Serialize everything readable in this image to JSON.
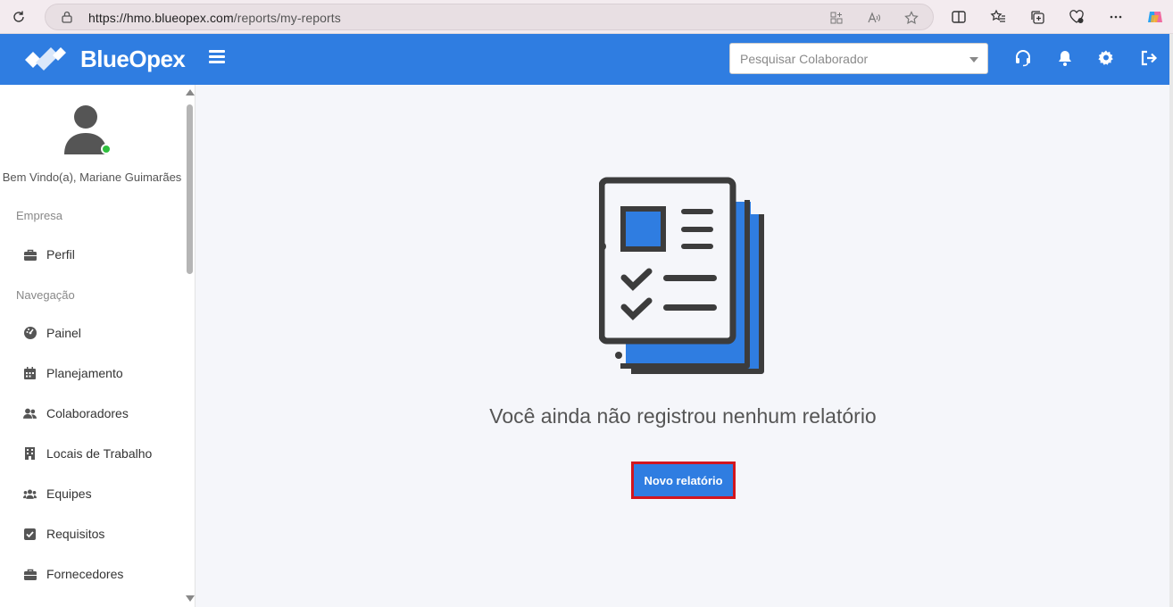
{
  "browser": {
    "url_host": "https://hmo.blueopex.com",
    "url_path": "/reports/my-reports",
    "icons": [
      "reload-icon",
      "lock-icon",
      "apps-icon",
      "read-aloud-icon",
      "favorite-star-icon",
      "split-screen-icon",
      "favorites-icon",
      "collections-icon",
      "health-icon",
      "more-icon",
      "copilot-icon"
    ]
  },
  "header": {
    "brand": "BlueOpex",
    "search_placeholder": "Pesquisar Colaborador",
    "brand_color": "#2f7de1"
  },
  "sidebar": {
    "welcome": "Bem Vindo(a), Mariane Guimarães",
    "section_company": "Empresa",
    "section_navigation": "Navegação",
    "company_items": [
      {
        "label": "Perfil",
        "icon": "briefcase-icon"
      }
    ],
    "nav_items": [
      {
        "label": "Painel",
        "icon": "dashboard-icon"
      },
      {
        "label": "Planejamento",
        "icon": "calendar-icon"
      },
      {
        "label": "Colaboradores",
        "icon": "users-icon"
      },
      {
        "label": "Locais de Trabalho",
        "icon": "building-icon"
      },
      {
        "label": "Equipes",
        "icon": "team-icon"
      },
      {
        "label": "Requisitos",
        "icon": "checkbox-icon"
      },
      {
        "label": "Fornecedores",
        "icon": "briefcase-icon"
      }
    ]
  },
  "main": {
    "empty_message": "Você ainda não registrou nenhum relatório",
    "new_report_button": "Novo relatório"
  }
}
